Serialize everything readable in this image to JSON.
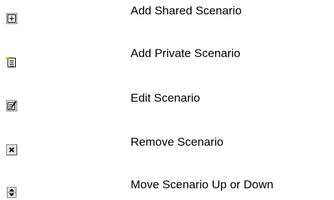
{
  "legend": {
    "items": [
      {
        "icon": "add-shared-scenario-icon",
        "label": "Add Shared Scenario"
      },
      {
        "icon": "add-private-scenario-icon",
        "label": "Add Private Scenario"
      },
      {
        "icon": "edit-scenario-icon",
        "label": "Edit Scenario"
      },
      {
        "icon": "remove-scenario-icon",
        "label": "Remove Scenario"
      },
      {
        "icon": "move-up-down-icon",
        "label": "Move Scenario Up or Down"
      }
    ]
  },
  "colors": {
    "text": "#000000",
    "icon_border": "#808080",
    "icon_dark": "#000000",
    "icon_face": "#ffffff",
    "icon_button_face": "#e6e6e6",
    "private_accent": "#f0c800",
    "remove_x": "#1a1a1a"
  }
}
